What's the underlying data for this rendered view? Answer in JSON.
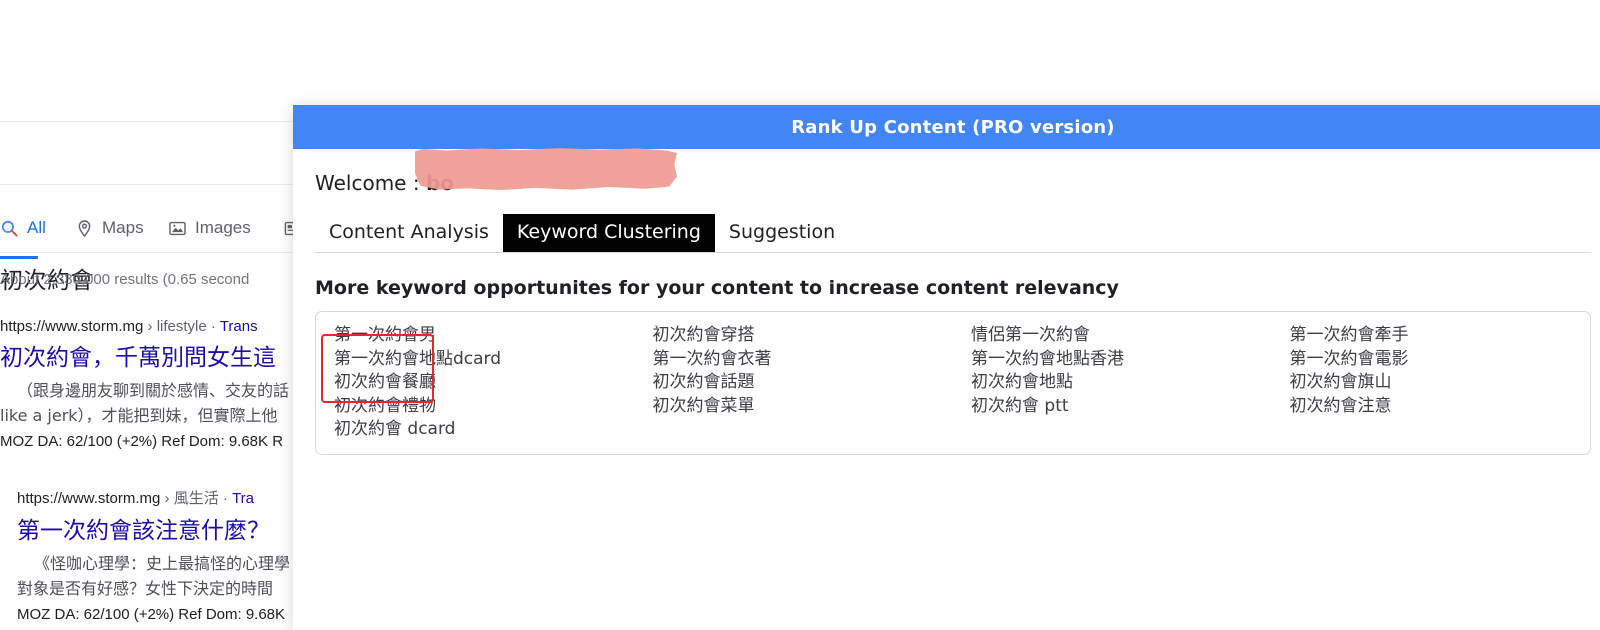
{
  "serp": {
    "query": "初次約會",
    "nav_items": [
      {
        "label": "All",
        "icon": "search-icon"
      },
      {
        "label": "Maps",
        "icon": "map-pin-icon"
      },
      {
        "label": "Images",
        "icon": "image-icon"
      },
      {
        "label": "",
        "icon": "news-icon"
      }
    ],
    "stats": "About 2,330,000 results (0.65 second",
    "results": [
      {
        "url_domain": "https://www.storm.mg",
        "url_crumb": "› lifestyle",
        "url_sep": "·",
        "url_translate": "Trans",
        "title": "初次約會，千萬別問女生這",
        "snippet_line1": "（跟身邊朋友聊到關於感情、交友的話",
        "snippet_line2": "like a jerk），才能把到妹，但實際上他",
        "moz": "MOZ DA: 62/100 (+2%)   Ref Dom: 9.68K    R"
      },
      {
        "url_domain": "https://www.storm.mg",
        "url_crumb": "› 風生活",
        "url_sep": "·",
        "url_translate": "Tra",
        "title": "第一次約會該注意什麼？",
        "snippet_line1": "《怪咖心理學：史上最搞怪的心理學",
        "snippet_line2": "對象是否有好感？女性下決定的時間",
        "moz": "MOZ DA: 62/100 (+2%)   Ref Dom: 9.68K"
      }
    ]
  },
  "panel": {
    "header_title": "Rank Up Content (PRO version)",
    "welcome_prefix": "Welcome : ",
    "welcome_user": "bo",
    "tabs": [
      {
        "label": "Content Analysis",
        "active": false
      },
      {
        "label": "Keyword Clustering",
        "active": true
      },
      {
        "label": "Suggestion",
        "active": false
      }
    ],
    "section_title": "More keyword opportunites for your content to increase content relevancy",
    "keyword_columns": [
      {
        "keywords": [
          "第一次約會男",
          "第一次約會地點dcard",
          "初次約會餐廳",
          "初次約會禮物",
          "初次約會 dcard"
        ]
      },
      {
        "keywords": [
          "初次約會穿搭",
          "第一次約會衣著",
          "初次約會話題",
          "初次約會菜單"
        ]
      },
      {
        "keywords": [
          "情侶第一次約會",
          "第一次約會地點香港",
          "初次約會地點",
          "初次約會 ptt"
        ]
      },
      {
        "keywords": [
          "第一次約會牽手",
          "第一次約會電影",
          "初次約會旗山",
          "初次約會注意"
        ]
      }
    ],
    "annotation": {
      "type": "red-rectangle",
      "color": "#e8262b"
    }
  },
  "colors": {
    "header_blue": "#4285f4",
    "active_tab_bg": "#000000",
    "link_blue": "#1a0dab",
    "google_blue": "#1a73e8",
    "annotation_red": "#e8262b",
    "redaction_pink": "#ef9a93"
  }
}
